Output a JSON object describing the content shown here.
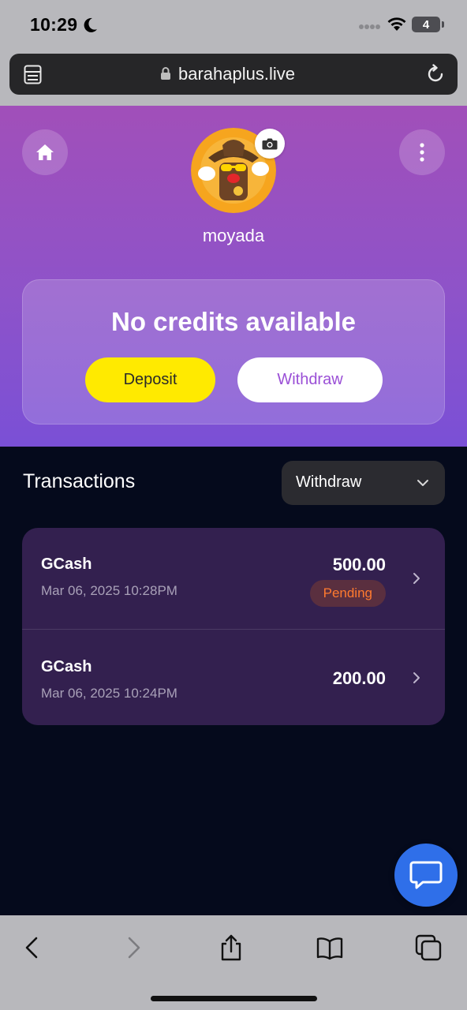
{
  "status_bar": {
    "time": "10:29",
    "battery": "4"
  },
  "browser": {
    "url": "barahaplus.live"
  },
  "profile": {
    "username": "moyada"
  },
  "credits": {
    "title": "No credits available",
    "deposit_label": "Deposit",
    "withdraw_label": "Withdraw"
  },
  "transactions": {
    "heading": "Transactions",
    "filter_selected": "Withdraw",
    "items": [
      {
        "method": "GCash",
        "date": "Mar 06, 2025 10:28PM",
        "amount": "500.00",
        "status": "Pending"
      },
      {
        "method": "GCash",
        "date": "Mar 06, 2025 10:24PM",
        "amount": "200.00"
      }
    ]
  },
  "icons": {
    "home": "home-icon",
    "more": "more-vertical-icon",
    "camera": "camera-icon",
    "chat": "chat-bubble-icon",
    "back": "chevron-left-icon",
    "forward": "chevron-right-icon",
    "share": "share-icon",
    "bookmarks": "book-icon",
    "tabs": "tabs-icon"
  },
  "colors": {
    "header_gradient_top": "#a14fb9",
    "header_gradient_bottom": "#7a50d6",
    "deposit_button": "#ffea00",
    "withdraw_text": "#9a4fd6",
    "page_background": "#050a1c",
    "list_background": "#33204f",
    "pending_text": "#ff7a2f",
    "chat_button": "#2f6fe9"
  }
}
